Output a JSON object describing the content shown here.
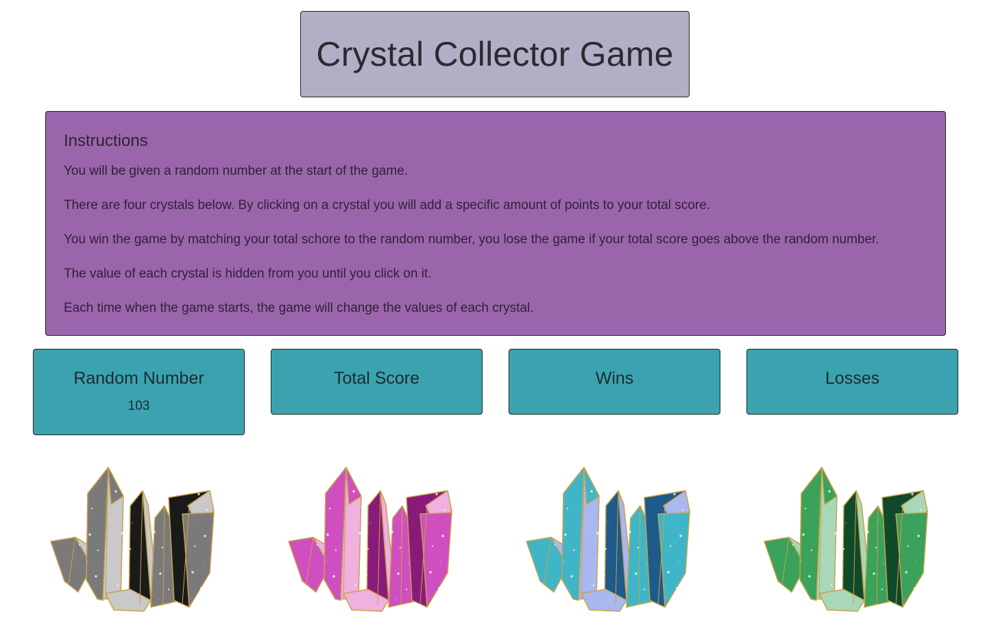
{
  "header": {
    "title": "Crystal Collector Game"
  },
  "instructions": {
    "heading": "Instructions",
    "lines": [
      "You will be given a random number at the start of the game.",
      "There are four crystals below. By clicking on a crystal you will add a specific amount of points to your total score.",
      "You win the game by matching your total schore to the random number, you lose the game if your total score goes above the random number.",
      "The value of each crystal is hidden from you until you click on it.",
      "Each time when the game starts, the game will change the values of each crystal."
    ]
  },
  "stats": {
    "random_number": {
      "label": "Random Number",
      "value": "103"
    },
    "total_score": {
      "label": "Total Score",
      "value": ""
    },
    "wins": {
      "label": "Wins",
      "value": ""
    },
    "losses": {
      "label": "Losses",
      "value": ""
    }
  },
  "crystals": [
    {
      "name": "black-crystal",
      "colors": [
        "#1a1a1a",
        "#7a7a7a",
        "#c9c9c9"
      ]
    },
    {
      "name": "pink-crystal",
      "colors": [
        "#8a1a7a",
        "#d04fc0",
        "#f0b0e0"
      ]
    },
    {
      "name": "blue-crystal",
      "colors": [
        "#1e5a8a",
        "#3fb6c8",
        "#a9b8f0"
      ]
    },
    {
      "name": "green-crystal",
      "colors": [
        "#0f4a2a",
        "#3aa25a",
        "#a8d8b8"
      ]
    }
  ],
  "colors": {
    "title_bg": "#b0afc6",
    "instructions_bg": "#9b65ac",
    "stat_bg": "#3ba3b0"
  }
}
